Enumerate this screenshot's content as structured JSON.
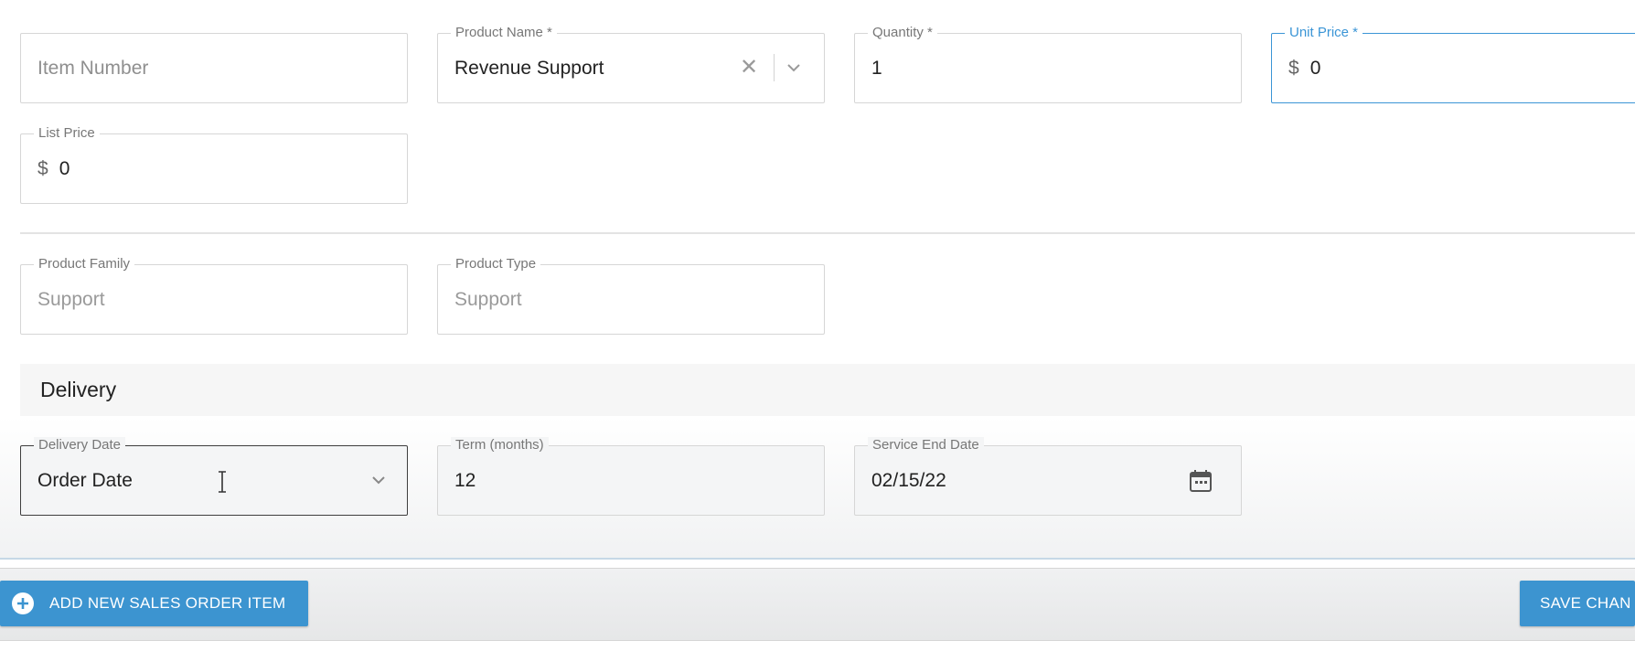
{
  "fields": {
    "item_number": {
      "label": "",
      "placeholder": "Item Number",
      "value": ""
    },
    "product_name": {
      "label": "Product Name *",
      "value": "Revenue Support",
      "clear_icon": "close-icon",
      "dropdown_icon": "chevron-down-icon"
    },
    "quantity": {
      "label": "Quantity *",
      "value": "1"
    },
    "unit_price": {
      "label": "Unit Price *",
      "prefix": "$",
      "value": "0"
    },
    "list_price": {
      "label": "List Price",
      "prefix": "$",
      "value": "0"
    },
    "product_family": {
      "label": "Product Family",
      "value": "Support"
    },
    "product_type": {
      "label": "Product Type",
      "value": "Support"
    }
  },
  "delivery": {
    "section_title": "Delivery",
    "delivery_date": {
      "label": "Delivery Date",
      "value": "Order Date",
      "dropdown_icon": "chevron-down-icon"
    },
    "term": {
      "label": "Term (months)",
      "value": "12"
    },
    "service_end_date": {
      "label": "Service End Date",
      "value": "02/15/22",
      "icon": "calendar-icon"
    }
  },
  "footer": {
    "add_button": {
      "label": "ADD NEW SALES ORDER ITEM",
      "icon": "plus-circle-icon"
    },
    "save_button": {
      "label": "SAVE CHAN"
    }
  },
  "colors": {
    "accent": "#3c94d0",
    "focus_border": "#3b95d6",
    "field_border": "#d6d6d6"
  }
}
